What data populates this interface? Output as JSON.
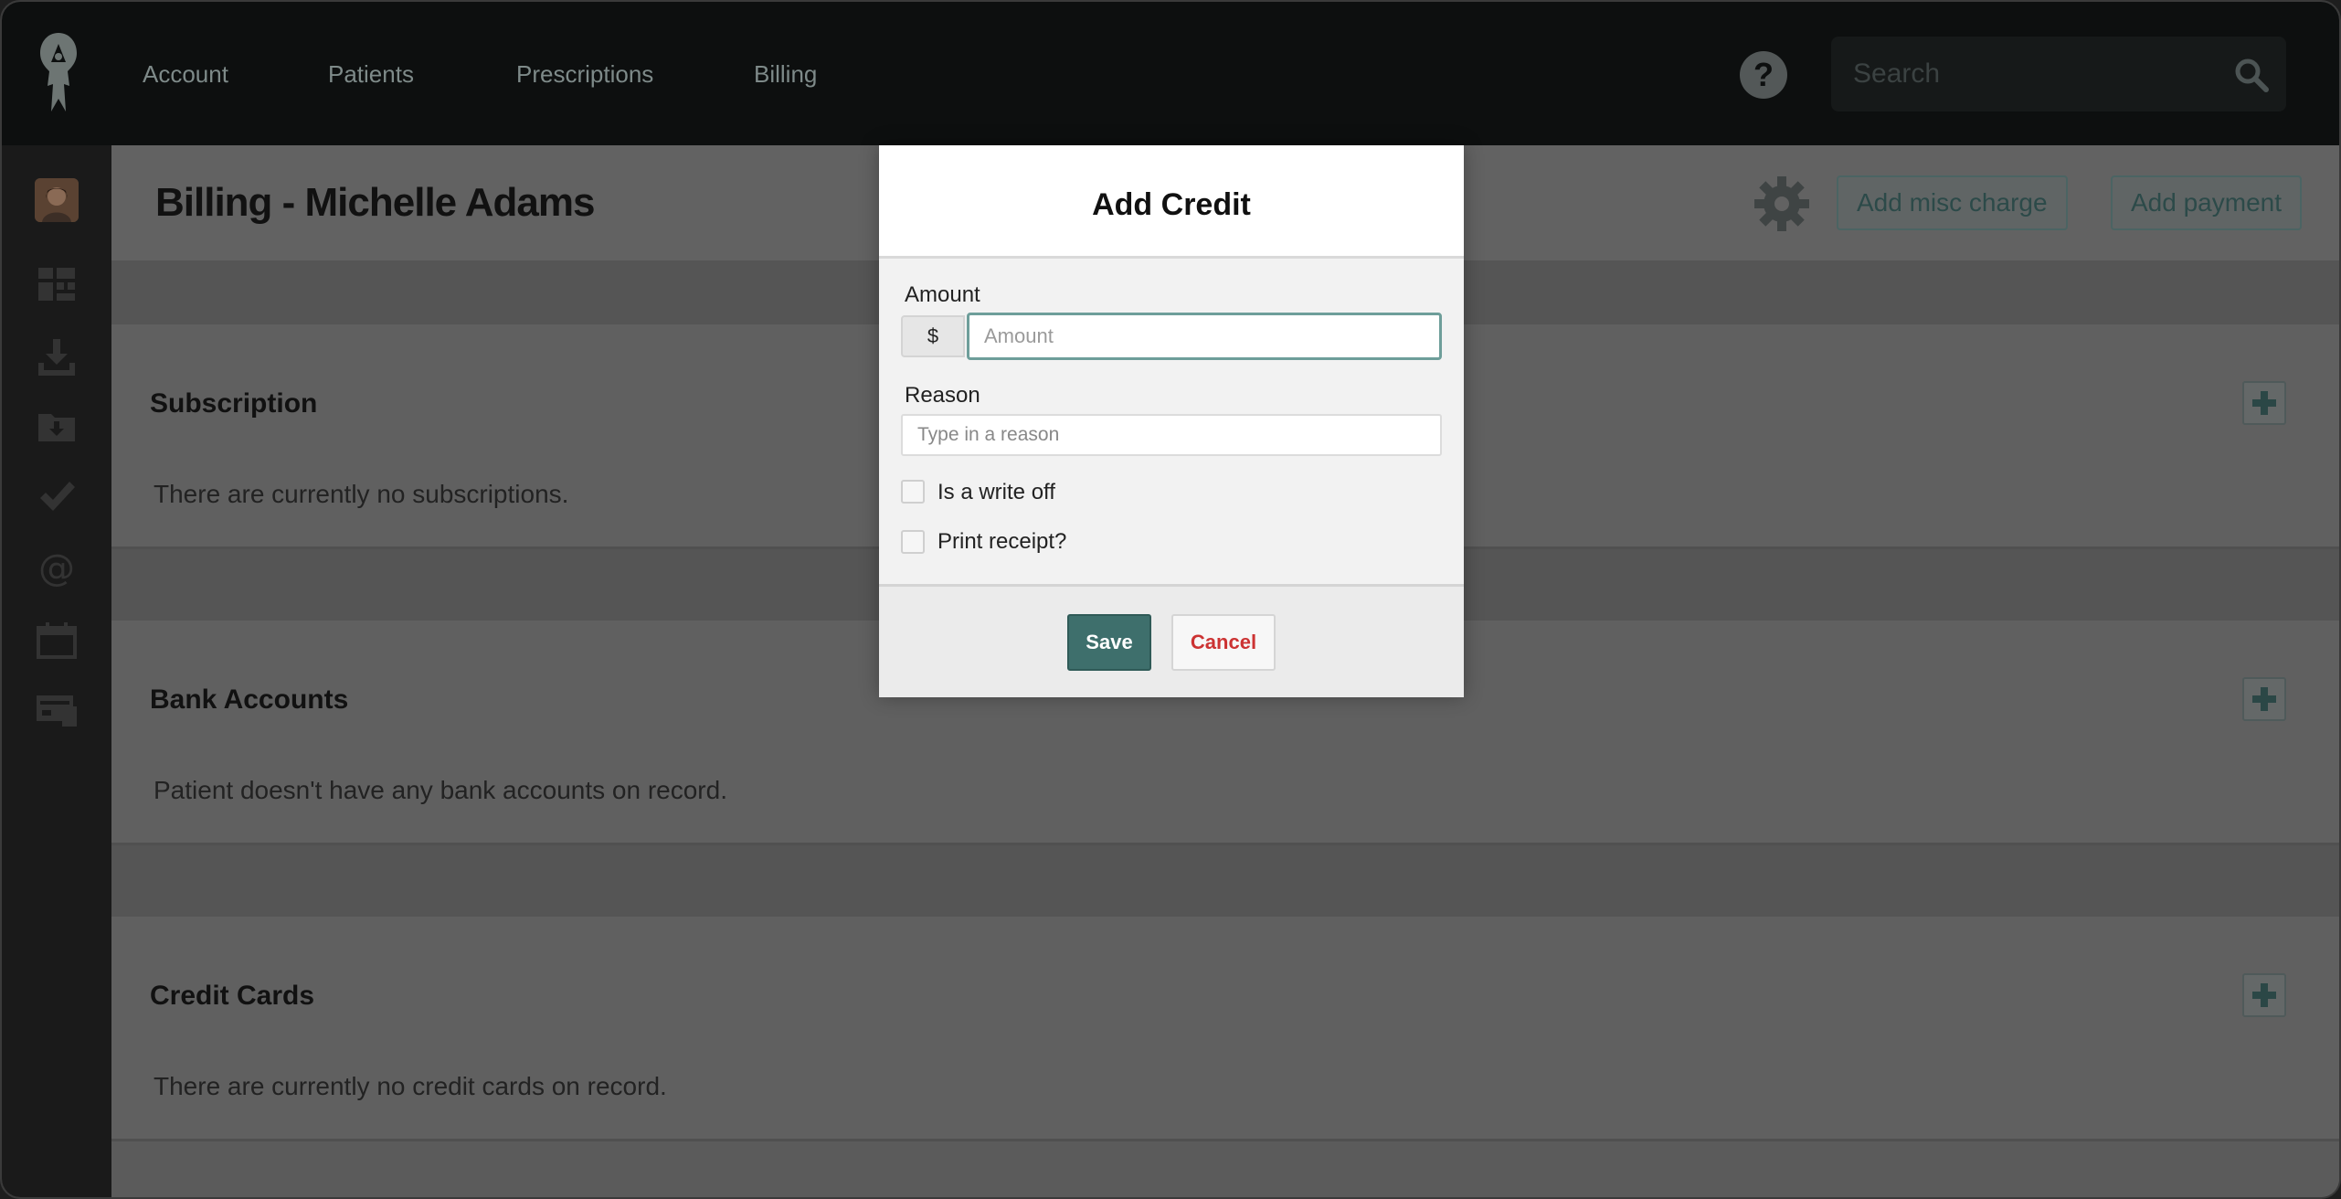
{
  "nav": {
    "items": [
      "Account",
      "Patients",
      "Prescriptions",
      "Billing"
    ],
    "search_placeholder": "Search"
  },
  "header": {
    "title": "Billing - Michelle Adams",
    "add_misc_charge": "Add misc charge",
    "add_payment": "Add payment"
  },
  "sections": [
    {
      "title": "Subscription",
      "text": "There are currently no subscriptions."
    },
    {
      "title": "Bank Accounts",
      "text": "Patient doesn't have any bank accounts on record."
    },
    {
      "title": "Credit Cards",
      "text": "There are currently no credit cards on record."
    }
  ],
  "modal": {
    "title": "Add Credit",
    "amount_label": "Amount",
    "currency_symbol": "$",
    "amount_placeholder": "Amount",
    "amount_value": "",
    "reason_label": "Reason",
    "reason_placeholder": "Type in a reason",
    "reason_value": "",
    "write_off_label": "Is a write off",
    "write_off_checked": false,
    "print_receipt_label": "Print receipt?",
    "print_receipt_checked": false,
    "save_label": "Save",
    "cancel_label": "Cancel"
  },
  "colors": {
    "accent": "#3e6f6c",
    "cancel": "#cc3333",
    "nav_bg": "#0d0f0f"
  },
  "icons": [
    "app-logo-icon",
    "help-icon",
    "search-icon",
    "dashboard-icon",
    "download-icon",
    "folder-download-icon",
    "checkmark-icon",
    "at-icon",
    "calendar-icon",
    "billing-icon",
    "gear-icon",
    "plus-icon"
  ]
}
